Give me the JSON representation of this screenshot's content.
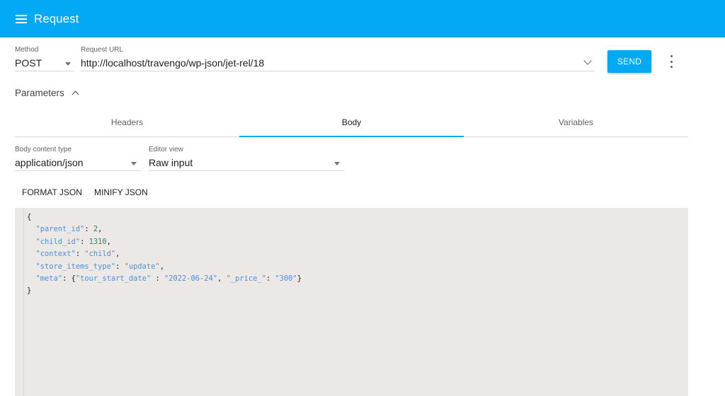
{
  "appbar": {
    "title": "Request",
    "menu_icon": "menu-icon"
  },
  "request": {
    "method_label": "Method",
    "method_value": "POST",
    "url_label": "Request URL",
    "url_value": "http://localhost/travengo/wp-json/jet-rel/18",
    "send_label": "SEND",
    "more_icon": "more-vert-icon"
  },
  "parameters": {
    "label": "Parameters"
  },
  "tabs": [
    {
      "label": "Headers",
      "active": false
    },
    {
      "label": "Body",
      "active": true
    },
    {
      "label": "Variables",
      "active": false
    }
  ],
  "body": {
    "content_type_label": "Body content type",
    "content_type_value": "application/json",
    "editor_view_label": "Editor view",
    "editor_view_value": "Raw input",
    "format_label": "FORMAT JSON",
    "minify_label": "MINIFY JSON"
  },
  "editor": {
    "lines": [
      "{",
      "  \"parent_id\": 2,",
      "  \"child_id\": 1310,",
      "  \"context\": \"child\",",
      "  \"store_items_type\": \"update\",",
      "  \"meta\": {\"tour_start_date\" : \"2022-06-24\", \"_price_\": \"300\"}",
      "}"
    ]
  },
  "colors": {
    "accent": "#03a9f4",
    "editor_bg": "#ebe8e5",
    "json_key": "#4f8fdc",
    "json_number": "#2e8b57"
  }
}
